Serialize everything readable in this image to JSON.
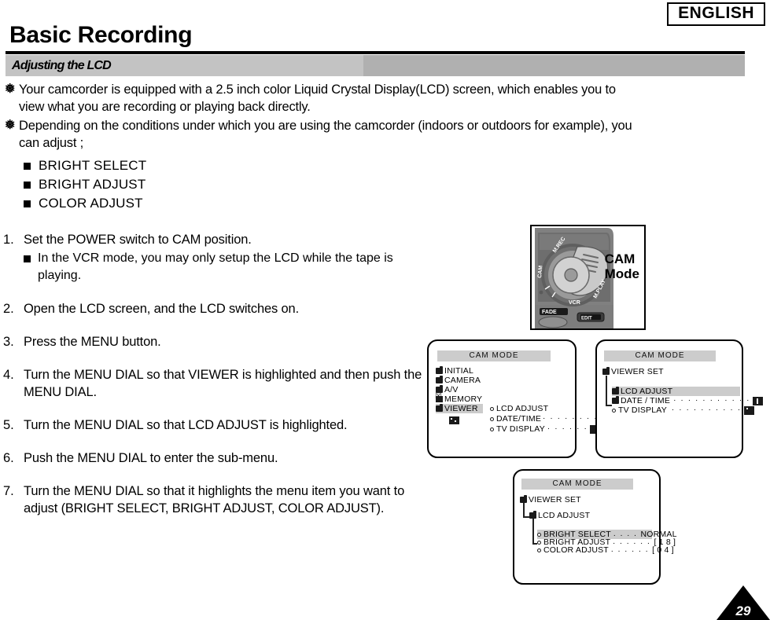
{
  "header": {
    "language_badge": "ENGLISH",
    "title": "Basic Recording",
    "section": "Adjusting the LCD"
  },
  "intro": {
    "marker": "❅",
    "paragraphs": [
      "Your camcorder is equipped with a 2.5 inch color Liquid Crystal Display(LCD) screen, which enables you to view what you are recording or playing back directly.",
      "Depending on the conditions under which you are using the camcorder (indoors or outdoors for example), you can adjust ;"
    ],
    "adjustables": [
      "BRIGHT SELECT",
      "BRIGHT ADJUST",
      "COLOR ADJUST"
    ]
  },
  "steps": [
    {
      "num": "1.",
      "text": "Set the POWER switch to CAM position.",
      "note": "In the VCR mode, you may only setup the LCD while the tape is playing."
    },
    {
      "num": "2.",
      "text": "Open the LCD screen, and the LCD switches on.",
      "note": ""
    },
    {
      "num": "3.",
      "text": "Press the MENU button.",
      "note": ""
    },
    {
      "num": "4.",
      "text": "Turn the MENU DIAL so that VIEWER is highlighted and then push the MENU DIAL.",
      "note": ""
    },
    {
      "num": "5.",
      "text": "Turn the MENU DIAL so that LCD ADJUST is highlighted.",
      "note": ""
    },
    {
      "num": "6.",
      "text": "Push the MENU DIAL to enter the sub-menu.",
      "note": ""
    },
    {
      "num": "7.",
      "text": "Turn the MENU DIAL so that it highlights the menu item you want to adjust (BRIGHT SELECT, BRIGHT ADJUST, COLOR ADJUST).",
      "note": ""
    }
  ],
  "camcorder": {
    "mode_label_line1": "CAM",
    "mode_label_line2": "Mode",
    "dial_positions": [
      "M.REC",
      "CAM",
      "VCR",
      "M.PLAY"
    ],
    "buttons": [
      "FADE",
      "EDIT"
    ]
  },
  "lcd_screens": [
    {
      "id": "lcd1",
      "title": "CAM  MODE",
      "items": [
        {
          "label": "INITIAL",
          "icon": "folder-icon",
          "highlight": false,
          "value": ""
        },
        {
          "label": "CAMERA",
          "icon": "folder-icon",
          "highlight": false,
          "value": ""
        },
        {
          "label": "A/V",
          "icon": "folder-icon",
          "highlight": false,
          "value": ""
        },
        {
          "label": "MEMORY",
          "icon": "memory-card-icon",
          "highlight": false,
          "value": ""
        },
        {
          "label": "VIEWER",
          "icon": "folder-icon",
          "highlight": true,
          "value": ""
        }
      ],
      "submenu": [
        {
          "label": "LCD ADJUST",
          "icon": "circle-bullet-icon",
          "value_icon": "",
          "dots": false
        },
        {
          "label": "DATE/TIME",
          "icon": "circle-bullet-icon",
          "value_icon": "dot-square-icon",
          "dots": true
        },
        {
          "label": "TV DISPLAY",
          "icon": "circle-bullet-icon",
          "value_icon": "solid-square-icon",
          "dots": true
        }
      ]
    },
    {
      "id": "lcd2",
      "title": "CAM  MODE",
      "root": "VIEWER SET",
      "items": [
        {
          "label": "LCD ADJUST",
          "icon": "folder-icon",
          "highlight": true,
          "value_icon": "",
          "dots": false
        },
        {
          "label": "DATE / TIME",
          "icon": "folder-icon",
          "highlight": false,
          "value_icon": "bar-square-icon",
          "dots": true
        },
        {
          "label": "TV DISPLAY",
          "icon": "circle-bullet-icon",
          "highlight": false,
          "value_icon": "dot-square-icon",
          "dots": true
        }
      ]
    },
    {
      "id": "lcd3",
      "title": "CAM  MODE",
      "root": "VIEWER SET",
      "branch": "LCD ADJUST",
      "items": [
        {
          "label": "BRIGHT SELECT",
          "dots": ". . . .",
          "value": "NORMAL",
          "highlight": true
        },
        {
          "label": "BRIGHT ADJUST",
          "dots": ". . . . . .",
          "value": "[ 1 8 ]",
          "highlight": false
        },
        {
          "label": "COLOR ADJUST",
          "dots": ". . . . . .",
          "value": "[ 0 4 ]",
          "highlight": false
        }
      ]
    }
  ],
  "footer": {
    "page_number": "29"
  },
  "colors": {
    "bar_light": "#c3c3c3",
    "bar_dark": "#b0b0b0",
    "lcd_highlight": "#cccccc",
    "ink": "#000000"
  }
}
